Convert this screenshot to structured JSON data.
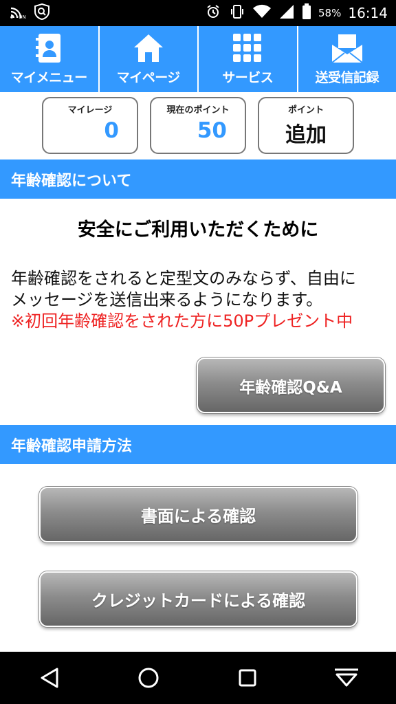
{
  "status_bar": {
    "battery_percent": "58%",
    "time": "16:14",
    "icons": [
      "cast-icon",
      "shield-icon",
      "alarm-icon",
      "vibrate-icon",
      "wifi-icon",
      "signal-icon",
      "battery-icon"
    ]
  },
  "nav": {
    "items": [
      {
        "label": "マイメニュー",
        "icon": "contacts-book-icon"
      },
      {
        "label": "マイページ",
        "icon": "home-icon"
      },
      {
        "label": "サービス",
        "icon": "grid-icon"
      },
      {
        "label": "送受信記録",
        "icon": "mail-icon"
      }
    ]
  },
  "points": {
    "mileage_label": "マイレージ",
    "mileage_value": "0",
    "current_label": "現在のポイント",
    "current_value": "50",
    "points_label": "ポイント",
    "add_label": "追加"
  },
  "age_section": {
    "header": "年齢確認について",
    "subtitle": "安全にご利用いただくために",
    "body_line1": "年齢確認をされると定型文のみならず、自由に",
    "body_line2": "メッセージを送信出来るようになります。",
    "notice": "※初回年齢確認をされた方に50Pプレゼント中",
    "qa_button": "年齢確認Q&A"
  },
  "apply_section": {
    "header": "年齢確認申請方法",
    "document_button": "書面による確認",
    "credit_card_button": "クレジットカードによる確認"
  },
  "system_nav": {
    "icons": [
      "back-icon",
      "home-circle-icon",
      "recents-icon",
      "hide-keyboard-icon"
    ]
  },
  "colors": {
    "accent": "#3399ff",
    "notice_red": "#ee2222",
    "value_blue": "#3399ff"
  }
}
